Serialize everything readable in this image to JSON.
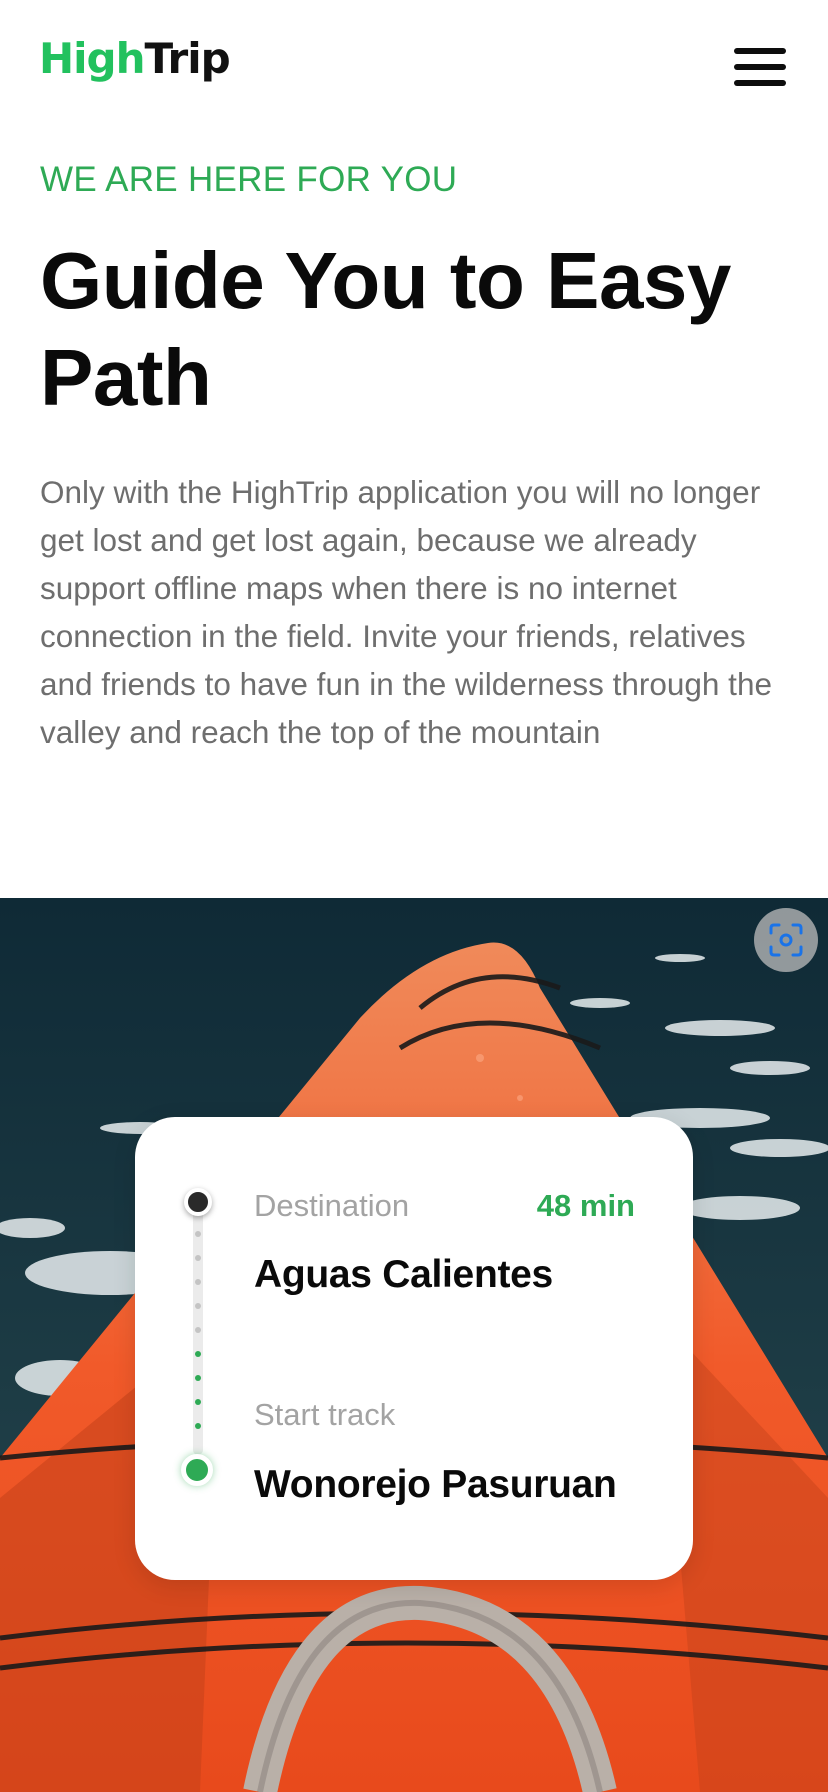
{
  "brand": {
    "logo_part1": "High",
    "logo_part2": "Trip",
    "accent_color": "#2eaa55"
  },
  "header": {
    "menu_icon": "hamburger-menu-icon"
  },
  "hero_text": {
    "eyebrow": "WE ARE HERE FOR YOU",
    "headline": "Guide You to Easy Path",
    "body": "Only with the HighTrip application you will no longer get lost and get lost again, because we already support offline maps when there is no internet connection in the field. Invite your friends, relatives and friends to have fun in the wilderness through the valley and reach the top of the mountain"
  },
  "image_overlay": {
    "scan_icon": "visual-search-icon"
  },
  "route_card": {
    "destination_label": "Destination",
    "destination_name": "Aguas Calientes",
    "duration": "48 min",
    "start_label": "Start track",
    "start_name": "Wonorejo Pasuruan"
  }
}
